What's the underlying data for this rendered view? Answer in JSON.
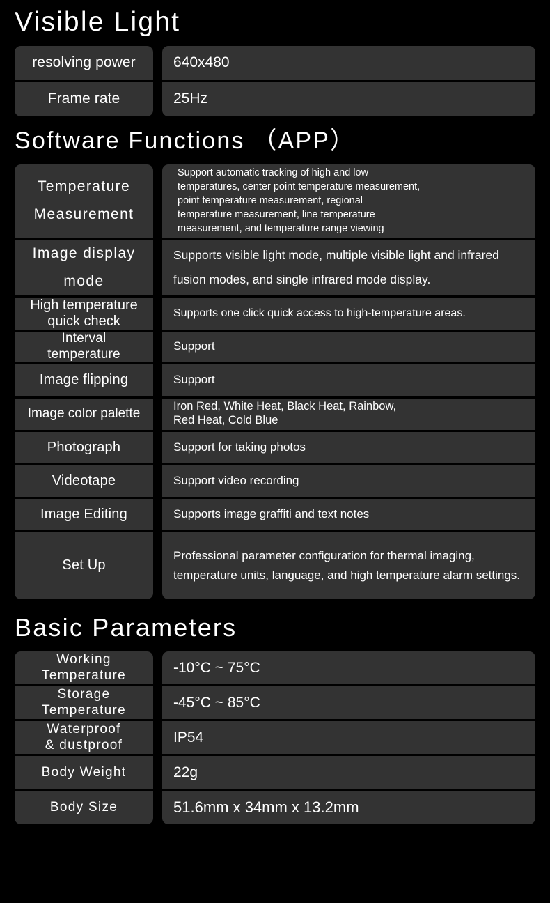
{
  "visible_light": {
    "title": "Visible Light",
    "rows": [
      {
        "label": "resolving power",
        "value": "640x480"
      },
      {
        "label": "Frame rate",
        "value": "25Hz"
      }
    ]
  },
  "software_functions": {
    "title": "Software Functions （APP）",
    "rows": [
      {
        "label": "Temperature\nMeasurement",
        "value": "Support automatic tracking of high and low\ntemperatures, center point temperature measurement,\npoint temperature measurement, regional\ntemperature measurement, line temperature\nmeasurement, and temperature range viewing"
      },
      {
        "label": "Image display\nmode",
        "value": "Supports visible light mode, multiple visible light and infrared fusion modes, and single infrared mode display."
      },
      {
        "label": "High temperature\nquick check",
        "value": "Supports one click quick access to high-temperature areas."
      },
      {
        "label": "Interval\ntemperature",
        "value": "Support"
      },
      {
        "label": "Image flipping",
        "value": "Support"
      },
      {
        "label": "Image color palette",
        "value": "Iron Red, White Heat, Black Heat, Rainbow,\nRed Heat, Cold Blue"
      },
      {
        "label": "Photograph",
        "value": "Support for taking photos"
      },
      {
        "label": "Videotape",
        "value": "Support video recording"
      },
      {
        "label": "Image Editing",
        "value": "Supports image graffiti and text notes"
      },
      {
        "label": "Set Up",
        "value": "Professional parameter configuration for thermal imaging, temperature units, language, and high temperature alarm settings."
      }
    ]
  },
  "basic_parameters": {
    "title": "Basic Parameters",
    "rows": [
      {
        "label": "Working\nTemperature",
        "value": "-10°C ~ 75°C"
      },
      {
        "label": "Storage\nTemperature",
        "value": "-45°C ~ 85°C"
      },
      {
        "label": "Waterproof\n& dustproof",
        "value": "IP54"
      },
      {
        "label": "Body Weight",
        "value": "22g"
      },
      {
        "label": "Body Size",
        "value": "51.6mm x 34mm x 13.2mm"
      }
    ]
  },
  "colors": {
    "background": "#000000",
    "cell_background": "#333333",
    "text": "#ffffff"
  }
}
